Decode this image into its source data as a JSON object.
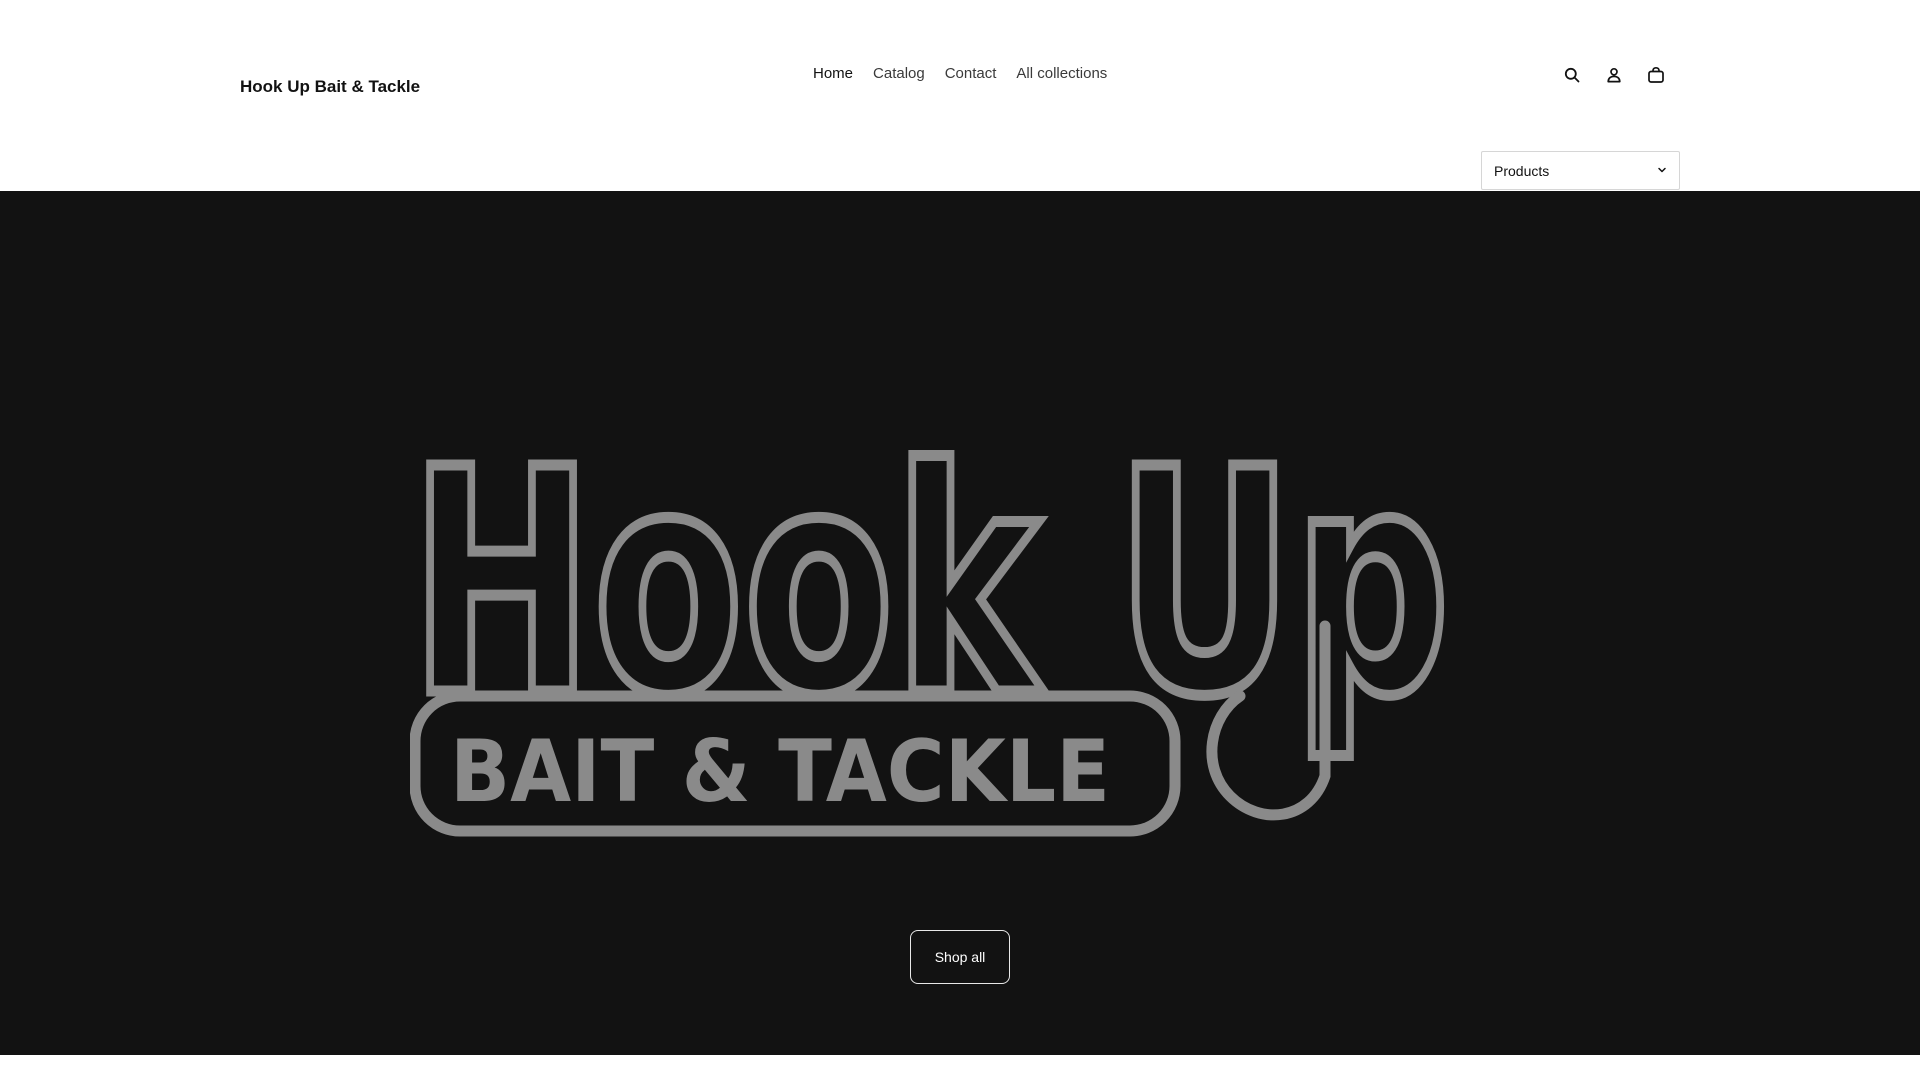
{
  "header": {
    "brand": "Hook Up Bait & Tackle",
    "nav": [
      {
        "label": "Home"
      },
      {
        "label": "Catalog"
      },
      {
        "label": "Contact"
      },
      {
        "label": "All collections"
      }
    ],
    "icons": [
      "search-icon",
      "account-icon",
      "cart-icon"
    ],
    "select": {
      "value": "Products"
    }
  },
  "hero": {
    "logo_line1": "Hook Up",
    "logo_line2": "BAIT & TACKLE",
    "button_label": "Shop all",
    "background": "#121212",
    "logo_color": "#8a8a8a"
  }
}
